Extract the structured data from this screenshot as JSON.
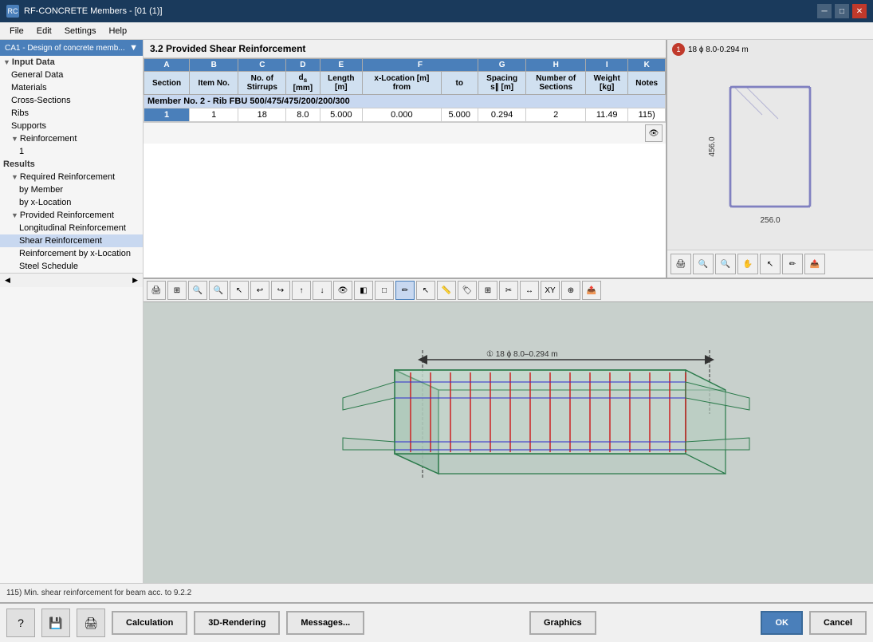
{
  "titleBar": {
    "title": "RF-CONCRETE Members - [01 (1)]",
    "icon": "RC"
  },
  "menuBar": {
    "items": [
      "File",
      "Edit",
      "Settings",
      "Help"
    ]
  },
  "sidebar": {
    "dropdown": "CA1 - Design of concrete memb...",
    "sections": [
      {
        "label": "Input Data",
        "level": "header",
        "expanded": true
      },
      {
        "label": "General Data",
        "level": "level1"
      },
      {
        "label": "Materials",
        "level": "level1"
      },
      {
        "label": "Cross-Sections",
        "level": "level1"
      },
      {
        "label": "Ribs",
        "level": "level1"
      },
      {
        "label": "Supports",
        "level": "level1"
      },
      {
        "label": "Reinforcement",
        "level": "level1",
        "expanded": true
      },
      {
        "label": "1",
        "level": "level2"
      },
      {
        "label": "Results",
        "level": "header"
      },
      {
        "label": "Required Reinforcement",
        "level": "level1",
        "expanded": true
      },
      {
        "label": "by Member",
        "level": "level2"
      },
      {
        "label": "by x-Location",
        "level": "level2"
      },
      {
        "label": "Provided Reinforcement",
        "level": "level1",
        "expanded": true
      },
      {
        "label": "Longitudinal Reinforcement",
        "level": "level2"
      },
      {
        "label": "Shear Reinforcement",
        "level": "level2",
        "selected": true
      },
      {
        "label": "Reinforcement by x-Location",
        "level": "level2"
      },
      {
        "label": "Steel Schedule",
        "level": "level2"
      }
    ]
  },
  "tableSection": {
    "title": "3.2  Provided Shear Reinforcement",
    "columns": {
      "A": "Section",
      "B": "Item No.",
      "C": "No. of Stirrups",
      "D": "ds [mm]",
      "E": "Length [m]",
      "F_from": "x-Location [m] from",
      "F_to": "to",
      "G": "Spacing s∥ [m]",
      "H": "Number of Sections",
      "I": "Weight [kg]",
      "K": "Notes"
    },
    "memberRow": "Member No. 2 - Rib FBU 500/475/475/200/200/300",
    "rows": [
      {
        "section": "1",
        "itemNo": "1",
        "noOfStirups": "18",
        "ds": "8.0",
        "length": "5.000",
        "xFrom": "0.000",
        "xTo": "5.000",
        "spacing": "0.294",
        "numSections": "2",
        "weight": "11.49",
        "notes": "115)"
      }
    ]
  },
  "crossSection": {
    "label": "18 ϕ 8.0-0.294 m",
    "circleNum": "1",
    "width": "256.0",
    "height": "456.0"
  },
  "graphicsToolbar": {
    "buttons": [
      "rotate",
      "zoom-in",
      "zoom-out",
      "pan",
      "select",
      "wire",
      "solid",
      "x-ray",
      "render",
      "light",
      "shadow",
      "section-cut",
      "measure",
      "annotate",
      "export"
    ]
  },
  "beamGraphic": {
    "label": "1  18 ϕ 8.0-0.294 m",
    "annotation": "1  18 ϕ 8.0-0.294 m"
  },
  "bottomBar": {
    "calculationBtn": "Calculation",
    "renderingBtn": "3D-Rendering",
    "messagesBtn": "Messages...",
    "graphicsBtn": "Graphics",
    "okBtn": "OK",
    "cancelBtn": "Cancel"
  },
  "statusBar": {
    "text": "115) Min. shear reinforcement for beam acc. to 9.2.2"
  }
}
